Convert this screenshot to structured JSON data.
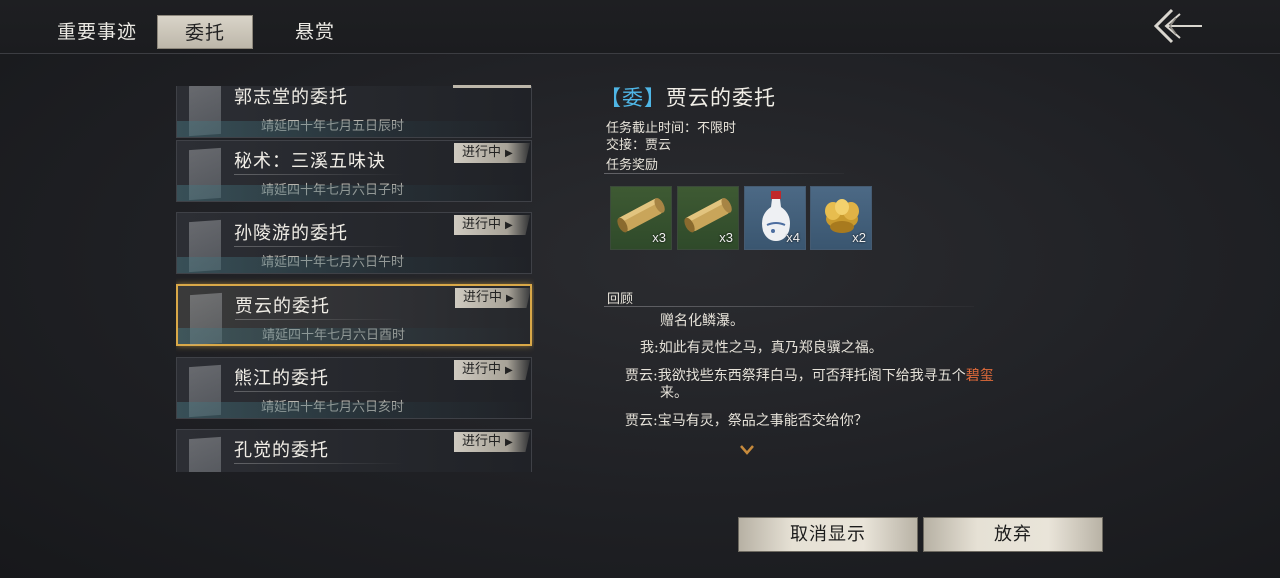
{
  "tabs": [
    {
      "label": "重要事迹",
      "active": false
    },
    {
      "label": "委托",
      "active": true
    },
    {
      "label": "悬赏",
      "active": false
    }
  ],
  "quests": [
    {
      "title": "郭志堂的委托",
      "date": "靖延四十年七月五日辰时",
      "status": ""
    },
    {
      "title": "秘术：三溪五味诀",
      "date": "靖延四十年七月六日子时",
      "status": "进行中"
    },
    {
      "title": "孙陵游的委托",
      "date": "靖延四十年七月六日午时",
      "status": "进行中"
    },
    {
      "title": "贾云的委托",
      "date": "靖延四十年七月六日酉时",
      "status": "进行中",
      "selected": true
    },
    {
      "title": "熊江的委托",
      "date": "靖延四十年七月六日亥时",
      "status": "进行中"
    },
    {
      "title": "孔觉的委托",
      "date": "",
      "status": "进行中"
    }
  ],
  "detail": {
    "bracket_open": "【",
    "tag": "委",
    "bracket_close": "】",
    "title": "贾云的委托",
    "deadline": "任务截止时间：不限时",
    "handover": "交接：贾云",
    "rewards_label": "任务奖励",
    "rewards": [
      {
        "icon": "scroll-icon",
        "qty": "x3",
        "color": "green"
      },
      {
        "icon": "scroll-icon",
        "qty": "x3",
        "color": "green"
      },
      {
        "icon": "porcelain-vase-icon",
        "qty": "x4",
        "color": "blue"
      },
      {
        "icon": "gold-ingot-icon",
        "qty": "x2",
        "color": "blue"
      }
    ],
    "review_label": "回顾",
    "dialogue": [
      {
        "speaker": "",
        "text": "赠名化鳞瀑。"
      },
      {
        "speaker": "我:",
        "text": "如此有灵性之马，真乃郑良骥之福。"
      },
      {
        "speaker": "贾云:",
        "text": "我欲找些东西祭拜白马，可否拜托阁下给我寻五个",
        "highlight": "碧玺",
        "text2": "来。"
      },
      {
        "speaker": "贾云:",
        "text": "宝马有灵，祭品之事能否交给你？"
      }
    ],
    "more_arrow": "⌄"
  },
  "buttons": {
    "hide": "取消显示",
    "abandon": "放弃"
  },
  "colors": {
    "accent_blue": "#4fb6e6",
    "highlight_orange": "#e06a3a",
    "selected_border": "#d9a848"
  }
}
